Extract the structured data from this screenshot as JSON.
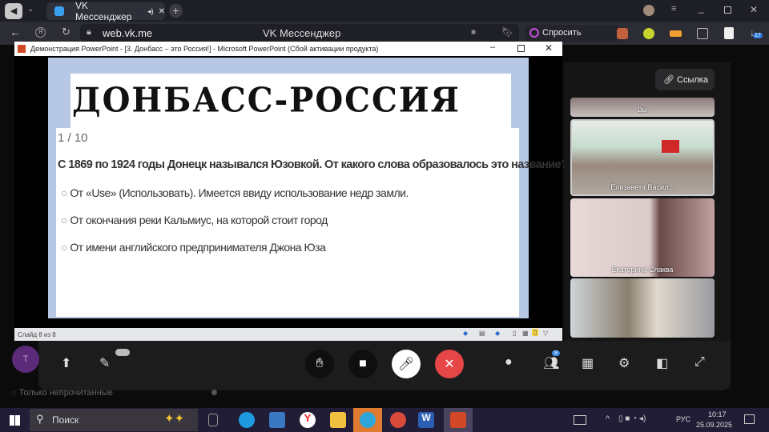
{
  "browser": {
    "tab_title": "VK Мессенджер",
    "url": "web.vk.me",
    "page_title": "VK Мессенджер",
    "ask_button": "Спросить",
    "downloads_badge": "17"
  },
  "powerpoint": {
    "window_title": "Демонстрация PowerPoint - [3. Донбасс – это Россия!] - Microsoft PowerPoint (Сбой активации продукта)",
    "slide_heading": "ДОНБАСС-РОССИЯ",
    "counter": "1 / 10",
    "question": "С 1869 по 1924 годы Донецк назывался Юзовкой. От какого слова образовалось это название?",
    "options": [
      "От «Use» (Использовать). Имеется ввиду использование недр замли.",
      "От окончания реки Кальмиус, на которой стоит город",
      "От имени английского предпринимателя Джона Юза"
    ],
    "status": "Слайд 8 из 8"
  },
  "call": {
    "link_button": "Ссылка",
    "participants": [
      {
        "name": "Вы"
      },
      {
        "name": "Елизавета Васил..."
      },
      {
        "name": "Екатерина Слаква"
      },
      {
        "name": ""
      }
    ],
    "participants_count": "9",
    "end_color": "#e64646"
  },
  "messenger": {
    "avatar_letter": "Т",
    "unread_filter": "Только непрочитанные"
  },
  "taskbar": {
    "search_placeholder": "Поиск",
    "language": "РУС",
    "time": "10:17",
    "date": "25.09.2025"
  }
}
